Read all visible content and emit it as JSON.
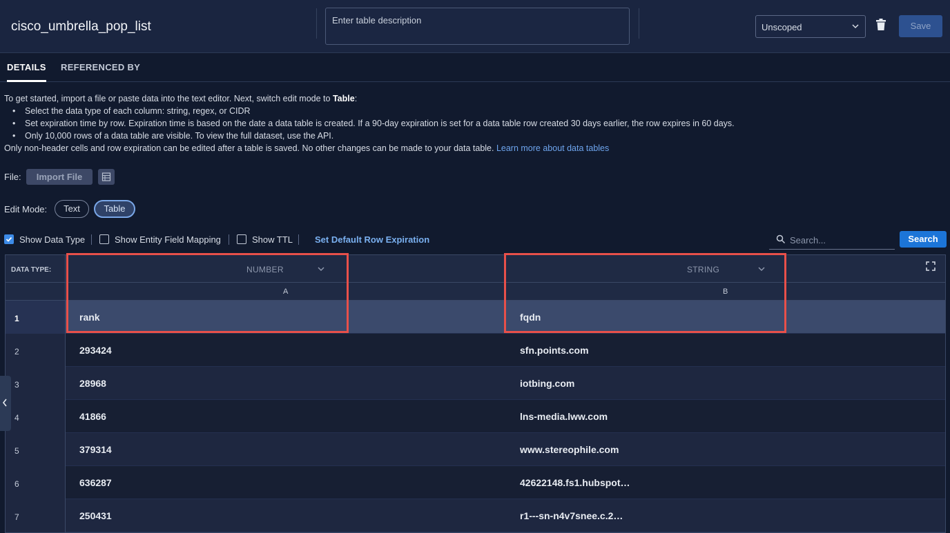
{
  "header": {
    "table_name": "cisco_umbrella_pop_list",
    "description_placeholder": "Enter table description",
    "scope": "Unscoped",
    "save_label": "Save"
  },
  "tabs": [
    {
      "label": "DETAILS",
      "active": true
    },
    {
      "label": "REFERENCED BY",
      "active": false
    }
  ],
  "intro": {
    "lead": "To get started, import a file or paste data into the text editor. Next, switch edit mode to ",
    "lead_bold": "Table",
    "lead_end": ":",
    "bullets": [
      "Select the data type of each column: string, regex, or CIDR",
      "Set expiration time by row. Expiration time is based on the date a data table is created. If a 90-day expiration is set for a data table row created 30 days earlier, the row expires in 60 days.",
      "Only 10,000 rows of a data table are visible. To view the full dataset, use the API."
    ],
    "footer": "Only non-header cells and row expiration can be edited after a table is saved. No other changes can be made to your data table. ",
    "learn_link": "Learn more about data tables"
  },
  "file": {
    "label": "File:",
    "import_label": "Import File"
  },
  "edit_mode": {
    "label": "Edit Mode:",
    "text_label": "Text",
    "table_label": "Table",
    "selected": "Table"
  },
  "options": {
    "show_data_type": {
      "label": "Show Data Type",
      "checked": true
    },
    "show_entity_mapping": {
      "label": "Show Entity Field Mapping",
      "checked": false
    },
    "show_ttl": {
      "label": "Show TTL",
      "checked": false
    },
    "default_expiration_link": "Set Default Row Expiration",
    "search_placeholder": "Search...",
    "search_button": "Search"
  },
  "grid": {
    "data_type_label": "DATA TYPE:",
    "columns": [
      {
        "letter": "A",
        "type": "NUMBER"
      },
      {
        "letter": "B",
        "type": "STRING"
      }
    ],
    "rows": [
      {
        "num": "1",
        "a": "rank",
        "b": "fqdn"
      },
      {
        "num": "2",
        "a": "293424",
        "b": "sfn.points.com"
      },
      {
        "num": "3",
        "a": "28968",
        "b": "iotbing.com"
      },
      {
        "num": "4",
        "a": "41866",
        "b": "lns-media.lww.com"
      },
      {
        "num": "5",
        "a": "379314",
        "b": "www.stereophile.com"
      },
      {
        "num": "6",
        "a": "636287",
        "b": "42622148.fs1.hubspot…"
      },
      {
        "num": "7",
        "a": "250431",
        "b": "r1---sn-n4v7snee.c.2…"
      }
    ]
  },
  "colors": {
    "accent": "#1c75d8",
    "highlight": "#e8504a",
    "link": "#6ea5ee"
  }
}
